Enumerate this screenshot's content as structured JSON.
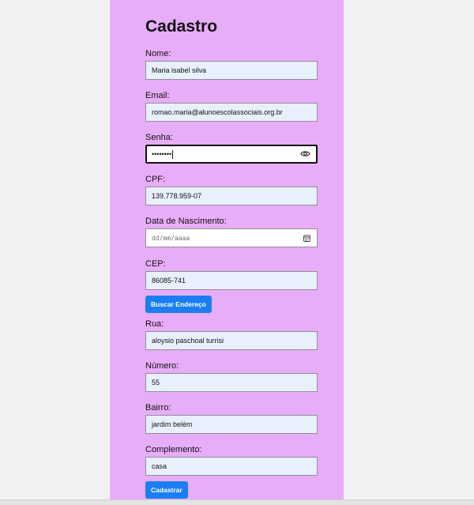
{
  "form": {
    "title": "Cadastro",
    "nome_label": "Nome:",
    "nome_value": "Maria isabel silva",
    "email_label": "Email:",
    "email_value": "romao.maria@alunoescolassociais.org.br",
    "senha_label": "Senha:",
    "senha_value": "••••••••",
    "cpf_label": "CPF:",
    "cpf_value": "139.778.959-07",
    "nascimento_label": "Data de Nascimento:",
    "nascimento_placeholder": "dd/mm/aaaa",
    "cep_label": "CEP:",
    "cep_value": "86085-741",
    "buscar_button": "Buscar Endereço",
    "rua_label": "Rua:",
    "rua_value": "aloysio paschoal turrisi",
    "numero_label": "Número:",
    "numero_value": "55",
    "bairro_label": "Bairro:",
    "bairro_value": "jardim belém",
    "complemento_label": "Complemento:",
    "complemento_value": "casa",
    "submit_button": "Cadastrar"
  },
  "colors": {
    "card_background": "#e8adf9",
    "page_background": "#f1f0f2",
    "autofill_background": "#e8f0fe",
    "button_blue": "#1a7ef2"
  },
  "icons": {
    "password_toggle": "eye-icon",
    "date_picker": "calendar-icon"
  }
}
